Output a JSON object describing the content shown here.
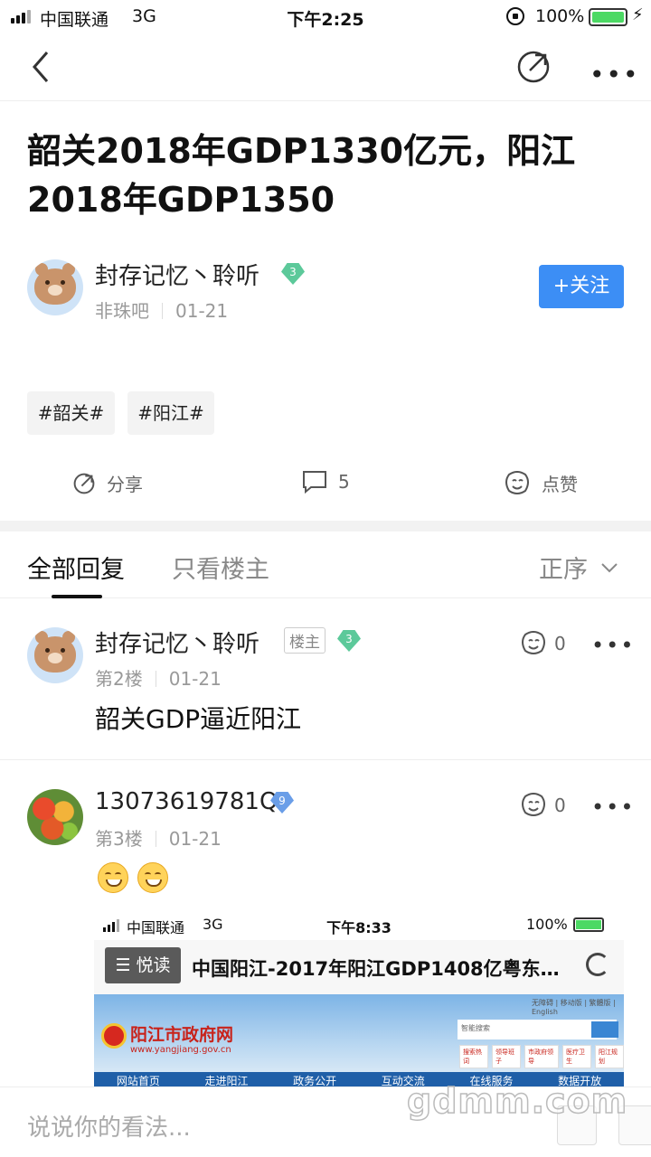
{
  "status": {
    "carrier": "中国联通",
    "network": "3G",
    "time": "下午2:25",
    "battery": "100%"
  },
  "post": {
    "title": "韶关2018年GDP1330亿元，阳江2018年GDP1350",
    "author": "封存记忆丶聆听",
    "level": "3",
    "forum": "非珠吧",
    "date": "01-21",
    "follow_label": "+关注",
    "tags": [
      "#韶关#",
      "#阳江#"
    ],
    "share_label": "分享",
    "comment_count": "5",
    "like_label": "点赞"
  },
  "tabs": {
    "all": "全部回复",
    "owner_only": "只看楼主",
    "sort": "正序"
  },
  "replies": [
    {
      "author": "封存记忆丶聆听",
      "owner_tag": "楼主",
      "level": "3",
      "floor": "第2楼",
      "date": "01-21",
      "likes": "0",
      "text": "韶关GDP逼近阳江"
    },
    {
      "author": "13073619781Q",
      "level": "9",
      "floor": "第3楼",
      "date": "01-21",
      "likes": "0"
    }
  ],
  "embedded": {
    "carrier": "中国联通",
    "network": "3G",
    "time": "下午8:33",
    "battery": "100%",
    "reader_label": "悦读",
    "page_title": "中国阳江-2017年阳江GDP1408亿粤东…",
    "site_name": "阳江市政府网",
    "site_url": "www.yangjiang.gov.cn",
    "top_links": "无障碍 | 移动版 | 繁體版 | English",
    "search_placeholder": "智能搜索",
    "chips": [
      "搜索热词",
      "领导班子",
      "市政府领导",
      "医疗卫生",
      "阳江规划"
    ],
    "nav": [
      "网站首页",
      "走进阳江",
      "政务公开",
      "互动交流",
      "在线服务",
      "数据开放"
    ]
  },
  "bottom": {
    "placeholder": "说说你的看法..."
  },
  "watermark": "gdmm.com"
}
